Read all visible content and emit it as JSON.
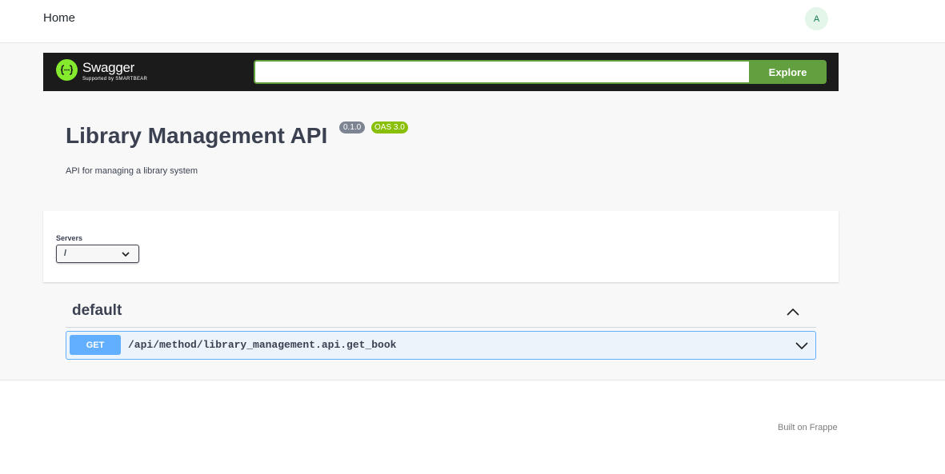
{
  "navbar": {
    "home_label": "Home",
    "avatar_initial": "A"
  },
  "swagger": {
    "logo_name": "Swagger",
    "logo_sub": "Supported by SMARTBEAR",
    "url_value": "",
    "explore_label": "Explore",
    "brand_color": "#85ea2d",
    "accent_color": "#62a03f"
  },
  "info": {
    "title": "Library Management API",
    "version": "0.1.0",
    "oas_version": "OAS 3.0",
    "description": "API for managing a library system"
  },
  "servers": {
    "label": "Servers",
    "selected": "/"
  },
  "tags": [
    {
      "name": "default",
      "expanded": true,
      "operations": [
        {
          "method": "GET",
          "path": "/api/method/library_management.api.get_book",
          "method_color": "#61affe"
        }
      ]
    }
  ],
  "footer": {
    "built_on": "Built on Frappe"
  }
}
